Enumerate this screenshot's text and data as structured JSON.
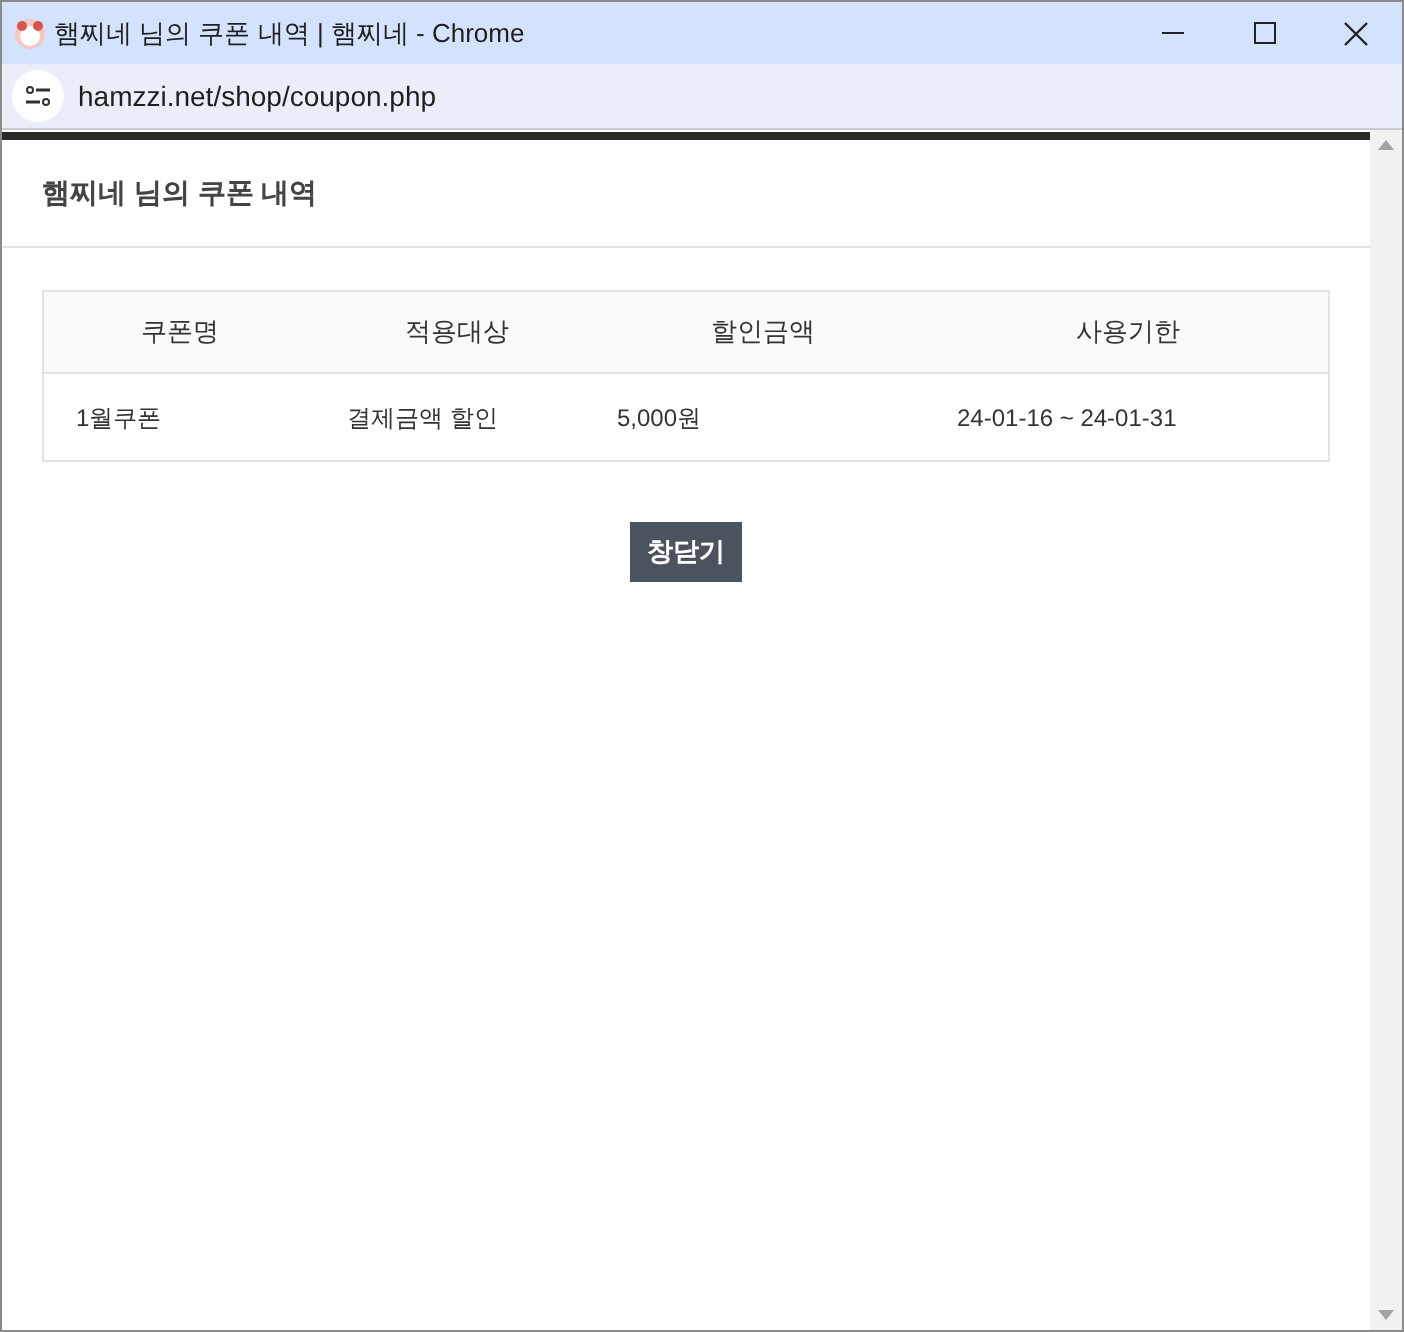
{
  "window": {
    "title": "햄찌네 님의 쿠폰 내역 | 햄찌네 - Chrome"
  },
  "address_bar": {
    "url": "hamzzi.net/shop/coupon.php"
  },
  "page": {
    "heading": "햄찌네 님의 쿠폰 내역"
  },
  "table": {
    "columns": [
      "쿠폰명",
      "적용대상",
      "할인금액",
      "사용기한"
    ],
    "rows": [
      [
        "1월쿠폰",
        "결제금액 할인",
        "5,000원",
        "24-01-16 ~ 24-01-31"
      ]
    ]
  },
  "close_button": "창닫기"
}
